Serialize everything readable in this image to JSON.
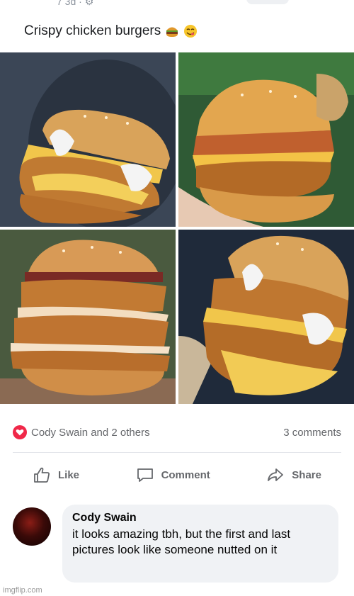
{
  "post": {
    "meta": "7 3d · ⚙",
    "caption": "Crispy chicken burgers",
    "emoji_icons": [
      "burger-emoji-icon",
      "yum-emoji-icon"
    ]
  },
  "photos": [
    {
      "alt": "photo-1",
      "bg": "#3b4656"
    },
    {
      "alt": "photo-2",
      "bg": "#2f5a35"
    },
    {
      "alt": "photo-3",
      "bg": "#4a5a3f"
    },
    {
      "alt": "photo-4",
      "bg": "#1f2a3a"
    }
  ],
  "reactions": {
    "summary": "Cody Swain and 2 others",
    "comments_count": "3 comments",
    "icon": "heart-reaction-icon",
    "color": "#f02849"
  },
  "actions": {
    "like": "Like",
    "comment": "Comment",
    "share": "Share"
  },
  "comment": {
    "author": "Cody Swain",
    "text": "it looks amazing tbh, but the first and last pictures look like someone nutted on it"
  },
  "watermark": "imgflip.com"
}
